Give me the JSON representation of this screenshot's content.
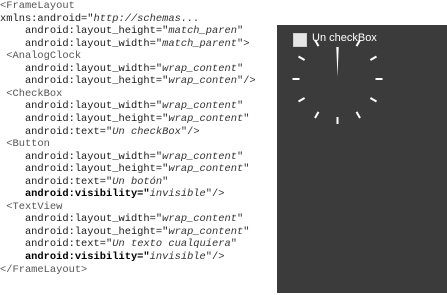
{
  "code_lines": [
    [
      {
        "t": "<FrameLayout",
        "c": "tag"
      }
    ],
    [
      {
        "t": "xmlns:android=\"",
        "c": "attr"
      },
      {
        "t": "http://schemas...",
        "c": "val"
      }
    ],
    [
      {
        "t": "    android:layout_height=\"",
        "c": "attr"
      },
      {
        "t": "match_paren",
        "c": "val"
      },
      {
        "t": "\"",
        "c": "punc"
      }
    ],
    [
      {
        "t": "    android:layout_width=\"",
        "c": "attr"
      },
      {
        "t": "match_parent",
        "c": "val"
      },
      {
        "t": "\">",
        "c": "punc"
      }
    ],
    [
      {
        "t": " <AnalogClock",
        "c": "tag"
      }
    ],
    [
      {
        "t": "    android:layout_width=\"",
        "c": "attr"
      },
      {
        "t": "wrap_content",
        "c": "val"
      },
      {
        "t": "\"",
        "c": "punc"
      }
    ],
    [
      {
        "t": "    android:layout_height=\"",
        "c": "attr"
      },
      {
        "t": "wrap_conten",
        "c": "val"
      },
      {
        "t": "\"/>",
        "c": "punc"
      }
    ],
    [
      {
        "t": " <CheckBox",
        "c": "tag"
      }
    ],
    [
      {
        "t": "    android:layout_width=\"",
        "c": "attr"
      },
      {
        "t": "wrap_content",
        "c": "val"
      },
      {
        "t": "\"",
        "c": "punc"
      }
    ],
    [
      {
        "t": "    android:layout_height=\"",
        "c": "attr"
      },
      {
        "t": "wrap_content",
        "c": "val"
      },
      {
        "t": "\"",
        "c": "punc"
      }
    ],
    [
      {
        "t": "    android:text=\"",
        "c": "attr"
      },
      {
        "t": "Un checkBox",
        "c": "val"
      },
      {
        "t": "\"/>",
        "c": "punc"
      }
    ],
    [
      {
        "t": " <Button",
        "c": "tag"
      }
    ],
    [
      {
        "t": "    android:layout_width=\"",
        "c": "attr"
      },
      {
        "t": "wrap_content",
        "c": "val"
      },
      {
        "t": "\"",
        "c": "punc"
      }
    ],
    [
      {
        "t": "    android:layout_height=\"",
        "c": "attr"
      },
      {
        "t": "wrap_content",
        "c": "val"
      },
      {
        "t": "\"",
        "c": "punc"
      }
    ],
    [
      {
        "t": "    android:text=\"",
        "c": "attr"
      },
      {
        "t": "Un botón",
        "c": "val"
      },
      {
        "t": "\"",
        "c": "punc"
      }
    ],
    [
      {
        "t": "    android:visibility=\"",
        "c": "bold"
      },
      {
        "t": "invisible",
        "c": "val"
      },
      {
        "t": "\"/>",
        "c": "punc"
      }
    ],
    [
      {
        "t": " <TextView",
        "c": "tag"
      }
    ],
    [
      {
        "t": "    android:layout_width=\"",
        "c": "attr"
      },
      {
        "t": "wrap_content",
        "c": "val"
      },
      {
        "t": "\"",
        "c": "punc"
      }
    ],
    [
      {
        "t": "    android:layout_height=\"",
        "c": "attr"
      },
      {
        "t": "wrap_content",
        "c": "val"
      },
      {
        "t": "\"",
        "c": "punc"
      }
    ],
    [
      {
        "t": "    android:text=\"",
        "c": "attr"
      },
      {
        "t": "Un texto cualquiera",
        "c": "val"
      },
      {
        "t": "\"",
        "c": "punc"
      }
    ],
    [
      {
        "t": "    android:visibility=\"",
        "c": "bold"
      },
      {
        "t": "invisible",
        "c": "val"
      },
      {
        "t": "\"/>",
        "c": "punc"
      }
    ],
    [
      {
        "t": "</FrameLayout>",
        "c": "tag"
      }
    ]
  ],
  "device": {
    "background": "#3b3b3b",
    "checkbox_label": "Un checkBox",
    "checkbox_checked": false,
    "clock_color": "#ffffff"
  }
}
